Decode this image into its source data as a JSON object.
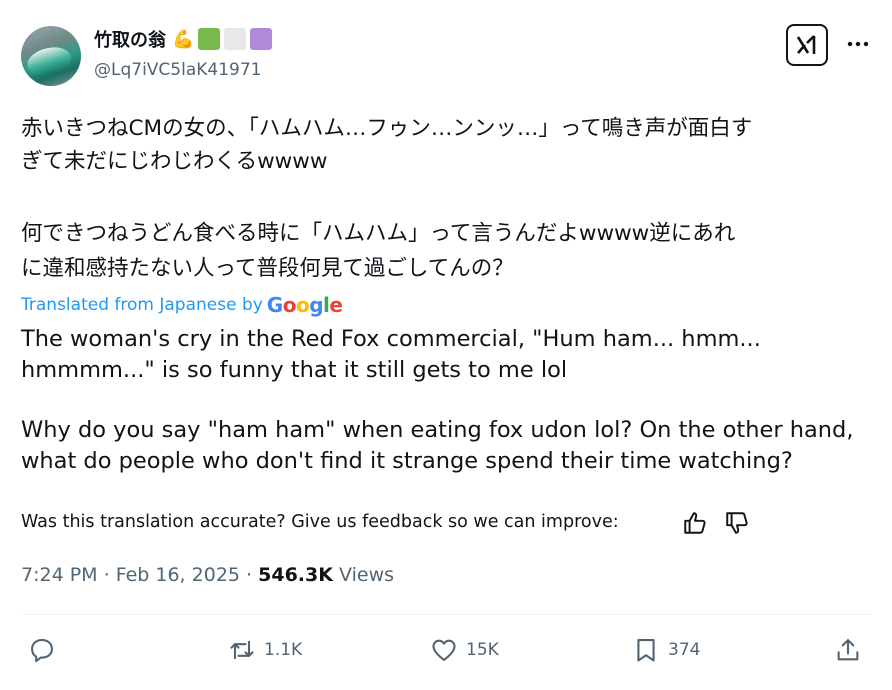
{
  "author": {
    "display_name": "竹取の翁",
    "emoji": "💪",
    "badge_colors": [
      "#79b94f",
      "#e8e8e8",
      "#b08ad9"
    ],
    "handle": "@Lq7iVC5laK41971"
  },
  "tweet": {
    "original_lines": [
      "赤いきつねCMの女の、「ハムハム…フゥン…ンンッ…」って鳴き声が面白す",
      "ぎて未だにじわじわくるwwww",
      "何できつねうどん食べる時に「ハムハム」って言うんだよwwww逆にあれ",
      "に違和感持たない人って普段何見て過ごしてんの？"
    ],
    "translated_from": "Translated from Japanese by",
    "translator": "Google",
    "translation_lines": [
      "The woman's cry in the Red Fox commercial, \"Hum ham... hmm...",
      "hmmmm...\" is so funny that it still gets to me lol",
      "Why do you say \"ham ham\" when eating fox udon lol? On the other hand,",
      "what do people who don't find it strange spend their time watching?"
    ],
    "feedback_prompt": "Was this translation accurate? Give us feedback so we can improve:"
  },
  "meta": {
    "time": "7:24 PM",
    "date": "Feb 16, 2025",
    "views_count": "546.3K",
    "views_label": "Views"
  },
  "actions": {
    "retweets": "1.1K",
    "likes": "15K",
    "bookmarks": "374"
  },
  "colors": {
    "accent": "#1d9bf0",
    "text": "#0f1419",
    "muted": "#536471"
  }
}
